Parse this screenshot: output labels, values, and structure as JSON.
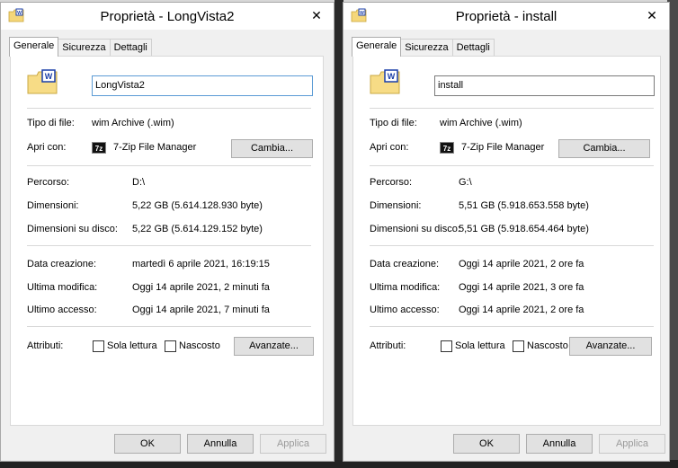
{
  "windows": [
    {
      "title": "Proprietà - LongVista2",
      "close_glyph": "✕",
      "tabs": [
        "Generale",
        "Sicurezza",
        "Dettagli"
      ],
      "filename": "LongVista2",
      "file_type_label": "Tipo di file:",
      "file_type_value": "wim Archive (.wim)",
      "open_with_label": "Apri con:",
      "open_with_icon_text": "7z",
      "open_with_value": "7-Zip File Manager",
      "change_button": "Cambia...",
      "path_label": "Percorso:",
      "path_value": "D:\\",
      "size_label": "Dimensioni:",
      "size_value": "5,22 GB (5.614.128.930 byte)",
      "disk_size_label": "Dimensioni su disco:",
      "disk_size_value": "5,22 GB (5.614.129.152 byte)",
      "created_label": "Data creazione:",
      "created_value": "martedì 6 aprile 2021, 16:19:15",
      "modified_label": "Ultima modifica:",
      "modified_value": "Oggi 14 aprile 2021, 2 minuti fa",
      "accessed_label": "Ultimo accesso:",
      "accessed_value": "Oggi 14 aprile 2021, 7 minuti fa",
      "attributes_label": "Attributi:",
      "readonly_label": "Sola lettura",
      "hidden_label": "Nascosto",
      "advanced_button": "Avanzate...",
      "ok_button": "OK",
      "cancel_button": "Annulla",
      "apply_button": "Applica"
    },
    {
      "title": "Proprietà - install",
      "close_glyph": "✕",
      "tabs": [
        "Generale",
        "Sicurezza",
        "Dettagli"
      ],
      "filename": "install",
      "file_type_label": "Tipo di file:",
      "file_type_value": "wim Archive (.wim)",
      "open_with_label": "Apri con:",
      "open_with_icon_text": "7z",
      "open_with_value": "7-Zip File Manager",
      "change_button": "Cambia...",
      "path_label": "Percorso:",
      "path_value": "G:\\",
      "size_label": "Dimensioni:",
      "size_value": "5,51 GB (5.918.653.558 byte)",
      "disk_size_label": "Dimensioni su disco:",
      "disk_size_value": "5,51 GB (5.918.654.464 byte)",
      "created_label": "Data creazione:",
      "created_value": "Oggi 14 aprile 2021, 2 ore fa",
      "modified_label": "Ultima modifica:",
      "modified_value": "Oggi 14 aprile 2021, 3 ore fa",
      "accessed_label": "Ultimo accesso:",
      "accessed_value": "Oggi 14 aprile 2021, 2 ore fa",
      "attributes_label": "Attributi:",
      "readonly_label": "Sola lettura",
      "hidden_label": "Nascosto",
      "advanced_button": "Avanzate...",
      "ok_button": "OK",
      "cancel_button": "Annulla",
      "apply_button": "Applica"
    }
  ],
  "icons": {
    "title_icon": "wim-file-icon",
    "file_icon": "wim-file-large-icon",
    "open_with_icon": "7zip-icon",
    "close_icon": "close-icon"
  },
  "colors": {
    "window_bg": "#f0f0f0",
    "panel_bg": "#ffffff",
    "input_focus": "#5b9bd5",
    "disabled_text": "#9a9a9a"
  }
}
